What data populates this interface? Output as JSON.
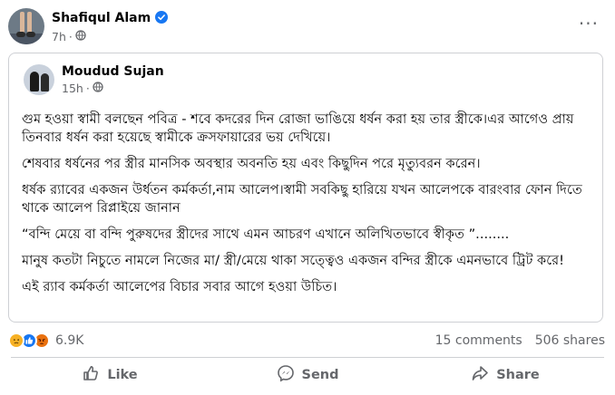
{
  "post": {
    "author": "Shafiqul Alam",
    "time": "7h",
    "more": "···"
  },
  "shared": {
    "author": "Moudud Sujan",
    "time": "15h",
    "paragraphs": [
      "গুম হওয়া স্বামী বলছেন পবিত্র - শবে কদরের দিন রোজা ভাঙিয়ে ধর্ষন করা হয় তার স্ত্রীকে।এর আগেও প্রায় তিনবার ধর্ষন করা হয়েছে স্বামীকে ক্রসফায়ারের ভয় দেখিয়ে।",
      "শেষবার ধর্ষনের পর স্ত্রীর মানসিক অবস্থার অবনতি হয় এবং কিছুদিন পরে মৃত্যুবরন করেন।",
      "ধর্ষক র‍্যাবের একজন উর্ধতন কর্মকর্তা,নাম আলেপ।স্বামী সবকিছু হারিয়ে যখন আলেপকে বারংবার ফোন দিতে থাকে আলেপ রিপ্লাইয়ে জানান",
      "“বন্দি মেয়ে বা বন্দি পুরুষদের স্ত্রীদের সাথে এমন আচরণ এখানে অলিখিতভাবে স্বীকৃত ”........",
      "মানুষ কতটা নিচুতে নামলে নিজের মা/ স্ত্রী/মেয়ে থাকা সত্ত্বেও একজন বন্দির স্ত্রীকে এমনভাবে ট্রিট করে!",
      "এই র‍্যাব কর্মকর্তা আলেপের বিচার সবার আগে হওয়া উচিত।"
    ]
  },
  "stats": {
    "reaction_count": "6.9K",
    "comments": "15 comments",
    "shares": "506 shares"
  },
  "actions": {
    "like": "Like",
    "send": "Send",
    "share": "Share"
  },
  "icons": {
    "verified": "verified-badge-icon",
    "audience": "globe-icon",
    "reactions": [
      "sad-icon",
      "like-icon",
      "angry-icon"
    ],
    "like": "thumbs-up-icon",
    "send": "messenger-icon",
    "share": "share-arrow-icon"
  },
  "colors": {
    "brand_blue": "#1877f2",
    "muted_text": "#65676b",
    "divider": "#ced0d4"
  }
}
